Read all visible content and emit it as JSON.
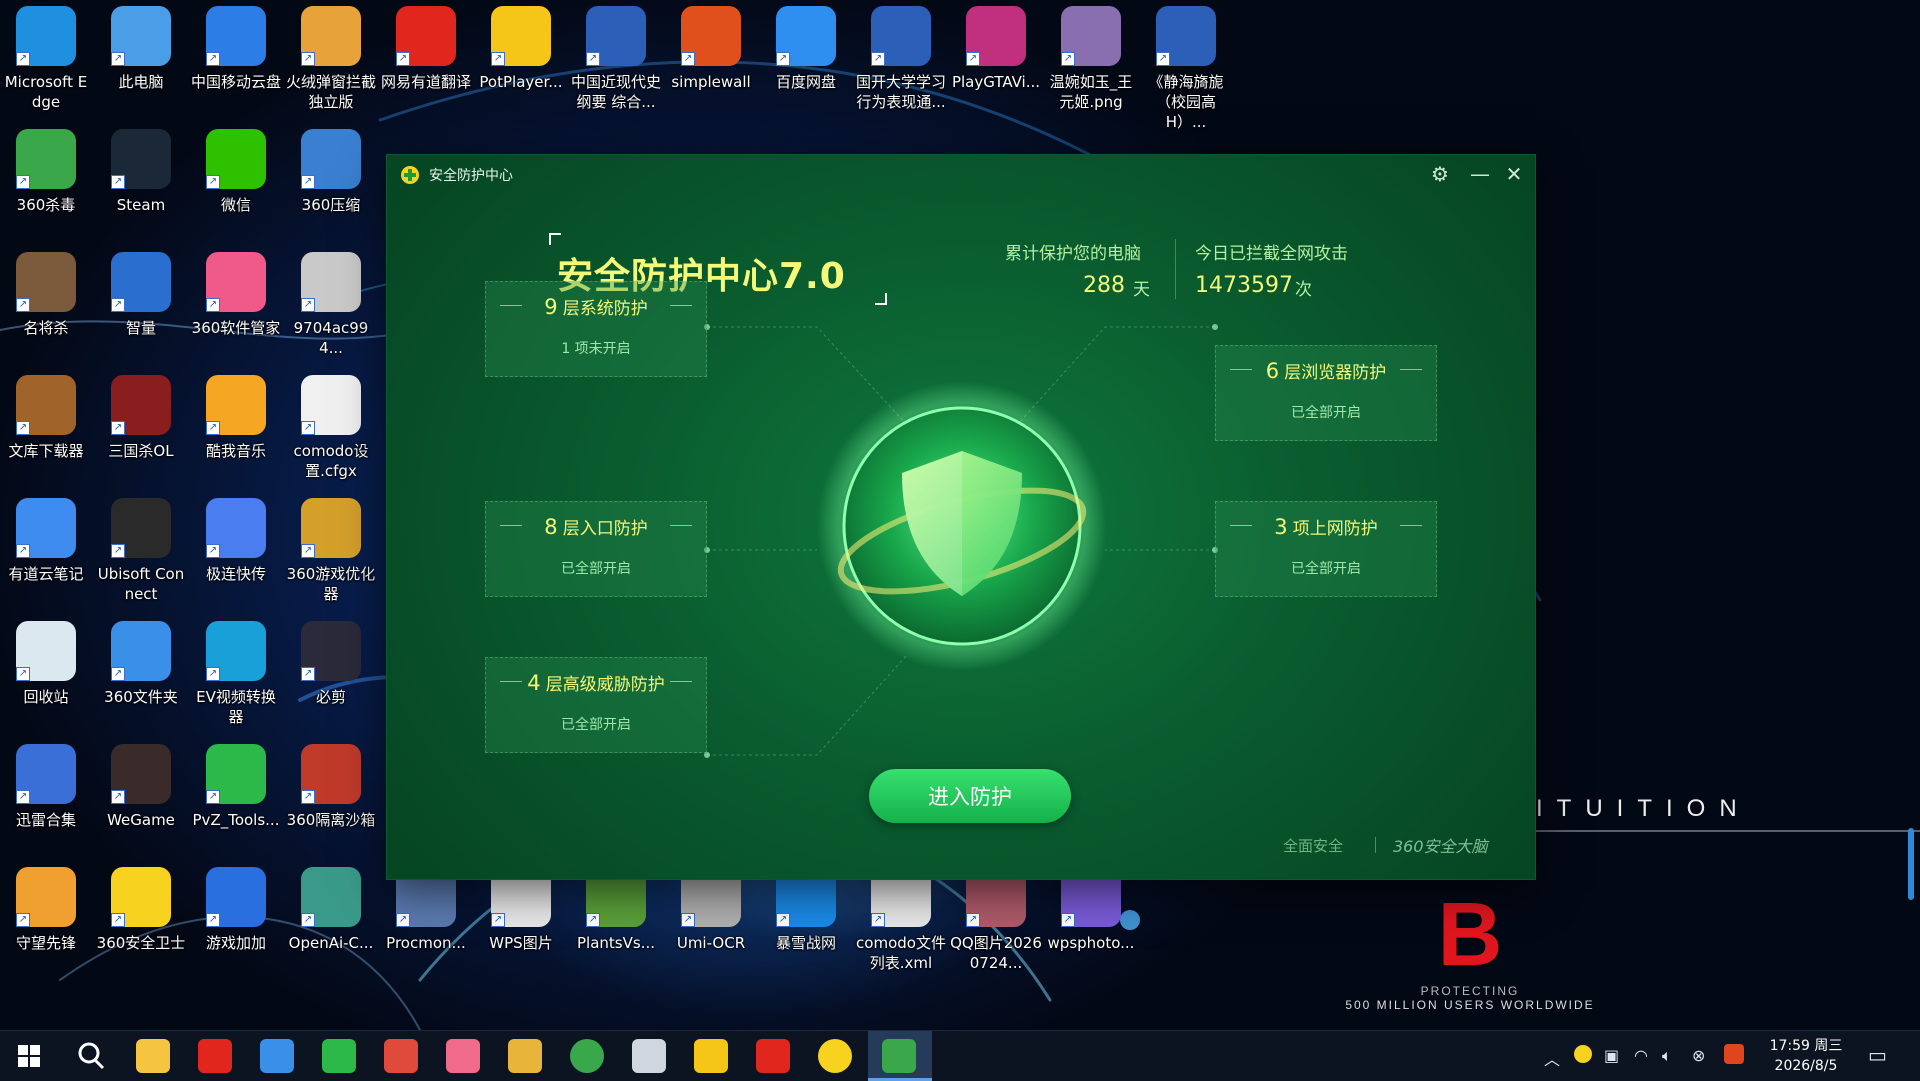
{
  "desktop_icons": [
    {
      "label": "Microsoft Edge",
      "color": "#1f8fe0"
    },
    {
      "label": "此电脑",
      "color": "#4a9ee8"
    },
    {
      "label": "中国移动云盘",
      "color": "#2c7de6"
    },
    {
      "label": "火绒弹窗拦截独立版",
      "color": "#e8a23a"
    },
    {
      "label": "网易有道翻译",
      "color": "#e0261d"
    },
    {
      "label": "PotPlayer...",
      "color": "#f5c518"
    },
    {
      "label": "中国近现代史纲要 综合...",
      "color": "#2b5fb8"
    },
    {
      "label": "simplewall",
      "color": "#e0501d"
    },
    {
      "label": "百度网盘",
      "color": "#2f8ff0"
    },
    {
      "label": "国开大学学习行为表现通...",
      "color": "#2b5fb8"
    },
    {
      "label": "PlayGTAVi...",
      "color": "#c0307e"
    },
    {
      "label": "温婉如玉_王元姬.png",
      "color": "#8a6fb0"
    },
    {
      "label": "《静海旖旎（校园高H）...",
      "color": "#2b5fb8"
    },
    {
      "label": "360杀毒",
      "color": "#3aa84a"
    },
    {
      "label": "Steam",
      "color": "#1b2838"
    },
    {
      "label": "微信",
      "color": "#2dc100"
    },
    {
      "label": "360压缩",
      "color": "#3a7fd0"
    },
    {
      "label": "名将杀",
      "color": "#7a5a3a"
    },
    {
      "label": "智量",
      "color": "#2a6fd0"
    },
    {
      "label": "360软件管家",
      "color": "#ef5a8a"
    },
    {
      "label": "9704ac994...",
      "color": "#c9c9c9"
    },
    {
      "label": "文库下载器",
      "color": "#a0642a"
    },
    {
      "label": "三国杀OL",
      "color": "#8a1e1e"
    },
    {
      "label": "酷我音乐",
      "color": "#f5a623"
    },
    {
      "label": "comodo设置.cfgx",
      "color": "#f0f0f0"
    },
    {
      "label": "有道云笔记",
      "color": "#3f8cf0"
    },
    {
      "label": "Ubisoft Connect",
      "color": "#2a2a2a"
    },
    {
      "label": "极连快传",
      "color": "#4a7ef0"
    },
    {
      "label": "360游戏优化器",
      "color": "#d4a02a"
    },
    {
      "label": "回收站",
      "color": "#dce8f0"
    },
    {
      "label": "360文件夹",
      "color": "#3a8fe8"
    },
    {
      "label": "EV视频转换器",
      "color": "#1aa0d8"
    },
    {
      "label": "必剪",
      "color": "#2a2a3a"
    },
    {
      "label": "迅雷合集",
      "color": "#3a6fd8"
    },
    {
      "label": "WeGame",
      "color": "#3a2a2a"
    },
    {
      "label": "PvZ_Tools...",
      "color": "#2db84a"
    },
    {
      "label": "360隔离沙箱",
      "color": "#c03a2a"
    },
    {
      "label": "守望先锋",
      "color": "#f0a030"
    },
    {
      "label": "360安全卫士",
      "color": "#f7d21e"
    },
    {
      "label": "游戏加加",
      "color": "#2a6fe0"
    },
    {
      "label": "OpenAi-C...",
      "color": "#3a9a8a"
    },
    {
      "label": "Procmon...",
      "color": "#5a7ab0"
    },
    {
      "label": "WPS图片",
      "color": "#e8e8e8"
    },
    {
      "label": "PlantsVs...",
      "color": "#5aa03a"
    },
    {
      "label": "Umi-OCR",
      "color": "#b0b0b0"
    },
    {
      "label": "暴雪战网",
      "color": "#1a8ae8"
    },
    {
      "label": "comodo文件列表.xml",
      "color": "#e8e8e8"
    },
    {
      "label": "QQ图片20260724...",
      "color": "#b05a6a"
    },
    {
      "label": "wpsphoto...",
      "color": "#7a5ad8"
    }
  ],
  "wallpaper": {
    "intuition_text": "ITUITION",
    "brand_letter": "B",
    "brand_line1": "PROTECTING",
    "brand_line2": "500 MILLION USERS WORLDWIDE"
  },
  "window": {
    "title": "安全防护中心",
    "hero_title": "安全防护中心7.0",
    "stat1": {
      "label": "累计保护您的电脑",
      "value": "288",
      "unit": "天"
    },
    "stat2": {
      "label": "今日已拦截全网攻击",
      "value": "1473597",
      "unit": "次"
    },
    "cards": [
      {
        "num": "9",
        "text": "层系统防护",
        "status": "1 项未开启"
      },
      {
        "num": "8",
        "text": "层入口防护",
        "status": "已全部开启"
      },
      {
        "num": "4",
        "text": "层高级威胁防护",
        "status": "已全部开启"
      },
      {
        "num": "6",
        "text": "层浏览器防护",
        "status": "已全部开启"
      },
      {
        "num": "3",
        "text": "项上网防护",
        "status": "已全部开启"
      }
    ],
    "enter_button": "进入防护",
    "footer_left": "全面安全",
    "footer_right": "360安全大脑",
    "colors": {
      "accent": "#f4f97a",
      "button": "#22c55a",
      "bg": "#0a5e30"
    }
  },
  "taskbar": {
    "clock_time": "17:59 周三",
    "clock_date": "2026/8/5",
    "tray_icons": [
      "chevron-up-icon",
      "360-tray-icon",
      "network-icon",
      "wifi-icon",
      "volume-icon",
      "close-circle-icon",
      "sogou-icon"
    ],
    "apps": [
      "windows-start-icon",
      "search-icon",
      "file-explorer-icon",
      "app-red-diamond-icon",
      "app-blue-note-icon",
      "app-green-sheet-icon",
      "app-red-window-icon",
      "app-bilibili-icon",
      "app-chrome-icon",
      "app-green-ball-icon",
      "app-screenshot-icon",
      "app-potplayer-icon",
      "app-wps-icon",
      "app-360-guard-icon",
      "app-shield-active-icon"
    ]
  }
}
